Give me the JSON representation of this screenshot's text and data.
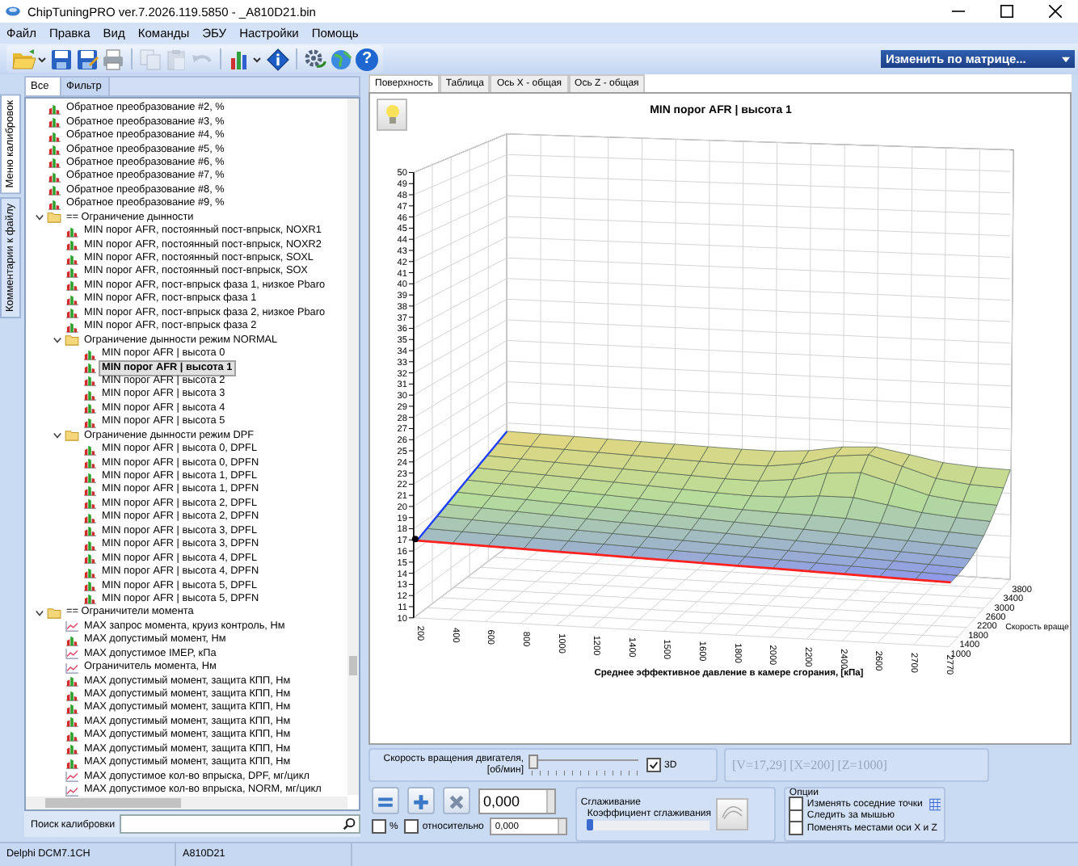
{
  "window": {
    "title": "ChipTuningPRO ver.7.2026.119.5850 - _A810D21.bin"
  },
  "menu": [
    "Файл",
    "Правка",
    "Вид",
    "Команды",
    "ЭБУ",
    "Настройки",
    "Помощь"
  ],
  "toolbar": [
    {
      "kind": "open",
      "disabled": false
    },
    {
      "kind": "save",
      "disabled": false
    },
    {
      "kind": "save-as",
      "disabled": false
    },
    {
      "kind": "print",
      "disabled": false
    },
    {
      "kind": "separator"
    },
    {
      "kind": "copy",
      "disabled": true
    },
    {
      "kind": "paste",
      "disabled": true
    },
    {
      "kind": "undo",
      "disabled": true
    },
    {
      "kind": "separator"
    },
    {
      "kind": "chart",
      "disabled": false
    },
    {
      "kind": "diamond",
      "disabled": false
    },
    {
      "kind": "separator"
    },
    {
      "kind": "gear",
      "disabled": false
    },
    {
      "kind": "globe",
      "disabled": false
    },
    {
      "kind": "help",
      "disabled": false,
      "glyph": "?"
    }
  ],
  "matrix_dropdown": {
    "label": "Изменить по матрице..."
  },
  "side_tabs": [
    {
      "label": "Меню калибровок",
      "selected": true
    },
    {
      "label": "Комментарии к файлу",
      "selected": false
    }
  ],
  "filter_tabs": [
    {
      "label": "Все",
      "selected": true
    },
    {
      "label": "Фильтр",
      "selected": false
    }
  ],
  "tree": [
    {
      "label": "Обратное преобразование #2, %",
      "kind": "map",
      "selected": false
    },
    {
      "label": "Обратное преобразование #3, %",
      "kind": "map",
      "selected": false
    },
    {
      "label": "Обратное преобразование #4, %",
      "kind": "map",
      "selected": false
    },
    {
      "label": "Обратное преобразование #5, %",
      "kind": "map",
      "selected": false
    },
    {
      "label": "Обратное преобразование #6, %",
      "kind": "map",
      "selected": false
    },
    {
      "label": "Обратное преобразование #7, %",
      "kind": "map",
      "selected": false
    },
    {
      "label": "Обратное преобразование #8, %",
      "kind": "map",
      "selected": false
    },
    {
      "label": "Обратное преобразование #9, %",
      "kind": "map",
      "selected": false
    },
    {
      "label": "== Ограничение дынности",
      "kind": "folder",
      "expanded": true,
      "children": [
        {
          "label": "MIN порог AFR, постоянный пост-впрыск, NOXR1",
          "kind": "map",
          "selected": false
        },
        {
          "label": "MIN порог AFR, постоянный пост-впрыск, NOXR2",
          "kind": "map",
          "selected": false
        },
        {
          "label": "MIN порог AFR, постоянный пост-впрыск, SOXL",
          "kind": "map",
          "selected": false
        },
        {
          "label": "MIN порог AFR, постоянный пост-впрыск, SOX",
          "kind": "map",
          "selected": false
        },
        {
          "label": "MIN порог AFR, пост-впрыск фаза 1, низкое Pbaro",
          "kind": "map",
          "selected": false
        },
        {
          "label": "MIN порог AFR, пост-впрыск фаза 1",
          "kind": "map",
          "selected": false
        },
        {
          "label": "MIN порог AFR, пост-впрыск фаза 2, низкое Pbaro",
          "kind": "map",
          "selected": false
        },
        {
          "label": "MIN порог AFR, пост-впрыск фаза 2",
          "kind": "map",
          "selected": false
        },
        {
          "label": "Ограничение дынности режим NORMAL",
          "kind": "folder",
          "expanded": true,
          "children": [
            {
              "label": "MIN порог AFR | высота 0",
              "kind": "map",
              "selected": false
            },
            {
              "label": "MIN порог AFR | высота 1",
              "kind": "map",
              "selected": true
            },
            {
              "label": "MIN порог AFR | высота 2",
              "kind": "map",
              "selected": false
            },
            {
              "label": "MIN порог AFR | высота 3",
              "kind": "map",
              "selected": false
            },
            {
              "label": "MIN порог AFR | высота 4",
              "kind": "map",
              "selected": false
            },
            {
              "label": "MIN порог AFR | высота 5",
              "kind": "map",
              "selected": false
            }
          ]
        },
        {
          "label": "Ограничение дынности режим DPF",
          "kind": "folder",
          "expanded": true,
          "children": [
            {
              "label": "MIN порог AFR | высота 0, DPFL",
              "kind": "map",
              "selected": false
            },
            {
              "label": "MIN порог AFR | высота 0, DPFN",
              "kind": "map",
              "selected": false
            },
            {
              "label": "MIN порог AFR | высота 1, DPFL",
              "kind": "map",
              "selected": false
            },
            {
              "label": "MIN порог AFR | высота 1, DPFN",
              "kind": "map",
              "selected": false
            },
            {
              "label": "MIN порог AFR | высота 2, DPFL",
              "kind": "map",
              "selected": false
            },
            {
              "label": "MIN порог AFR | высота 2, DPFN",
              "kind": "map",
              "selected": false
            },
            {
              "label": "MIN порог AFR | высота 3, DPFL",
              "kind": "map",
              "selected": false
            },
            {
              "label": "MIN порог AFR | высота 3, DPFN",
              "kind": "map",
              "selected": false
            },
            {
              "label": "MIN порог AFR | высота 4, DPFL",
              "kind": "map",
              "selected": false
            },
            {
              "label": "MIN порог AFR | высота 4, DPFN",
              "kind": "map",
              "selected": false
            },
            {
              "label": "MIN порог AFR | высота 5, DPFL",
              "kind": "map",
              "selected": false
            },
            {
              "label": "MIN порог AFR | высота 5, DPFN",
              "kind": "map",
              "selected": false
            }
          ]
        }
      ]
    },
    {
      "label": "== Ограничители момента",
      "kind": "folder",
      "expanded": true,
      "children": [
        {
          "label": "MAX запрос момента, круиз контроль, Нм",
          "kind": "curve",
          "selected": false
        },
        {
          "label": "MAX допустимый момент, Нм",
          "kind": "map",
          "selected": false
        },
        {
          "label": "MAX допустимое IMEP, кПа",
          "kind": "curve",
          "selected": false
        },
        {
          "label": "Ограничитель момента, Нм",
          "kind": "curve",
          "selected": false
        },
        {
          "label": "MAX допустимый момент, защита КПП, Нм",
          "kind": "map",
          "selected": false
        },
        {
          "label": "MAX допустимый момент, защита КПП, Нм",
          "kind": "map",
          "selected": false
        },
        {
          "label": "MAX допустимый момент, защита КПП, Нм",
          "kind": "map",
          "selected": false
        },
        {
          "label": "MAX допустимый момент, защита КПП, Нм",
          "kind": "map",
          "selected": false
        },
        {
          "label": "MAX допустимый момент, защита КПП, Нм",
          "kind": "map",
          "selected": false
        },
        {
          "label": "MAX допустимый момент, защита КПП, Нм",
          "kind": "map",
          "selected": false
        },
        {
          "label": "MAX допустимый момент, защита КПП, Нм",
          "kind": "map",
          "selected": false
        },
        {
          "label": "MAX допустимое кол-во впрыска, DPF, мг/цикл",
          "kind": "curve",
          "selected": false
        },
        {
          "label": "MAX допустимое кол-во впрыска, NORM, мг/цикл",
          "kind": "curve",
          "selected": false
        }
      ]
    }
  ],
  "search": {
    "label": "Поиск калибровки"
  },
  "view_tabs": [
    {
      "label": "Поверхность",
      "selected": true
    },
    {
      "label": "Таблица",
      "selected": false
    },
    {
      "label": "Ось X - общая",
      "selected": false
    },
    {
      "label": "Ось Z - общая",
      "selected": false
    }
  ],
  "surface": {
    "title": "MIN порог AFR | высота 1",
    "z_ticks": [
      "50",
      "49",
      "48",
      "47",
      "46",
      "45",
      "44",
      "43",
      "42",
      "41",
      "40",
      "39",
      "38",
      "37",
      "36",
      "35",
      "34",
      "33",
      "32",
      "31",
      "30",
      "29",
      "28",
      "27",
      "26",
      "25",
      "24",
      "23",
      "22",
      "21",
      "20",
      "19",
      "18",
      "17",
      "16",
      "15",
      "14",
      "13",
      "12",
      "11",
      "10"
    ],
    "x_ticks": [
      "200",
      "400",
      "600",
      "800",
      "1000",
      "1200",
      "1400",
      "1500",
      "1600",
      "1800",
      "2000",
      "2200",
      "2400",
      "2600",
      "2700",
      "2770"
    ],
    "depth_ticks": [
      "3800",
      "3400",
      "3000",
      "2600",
      "2200",
      "1800",
      "1400",
      "1000"
    ],
    "x_label": "Среднее эффективное давление в камере сгорания, [кПа]",
    "depth_label": "Скорость враще"
  },
  "rpm_slider": {
    "label": "Скорость вращения двигателя, [об/мин]",
    "level": 0
  },
  "view_3d": {
    "label": "3D",
    "checked": true
  },
  "readout": "[V=17,29] [X=200] [Z=1000]",
  "edit": {
    "value": "0,000",
    "percent": {
      "label": "%",
      "checked": false
    },
    "relative": {
      "label": "относительно",
      "checked": false
    },
    "relative_value": "0,000"
  },
  "smoothing": {
    "title": "Сглаживание",
    "label": "Коэффициент сглаживания",
    "level": 0
  },
  "options": {
    "title": "Опции",
    "items": [
      {
        "label": "Изменять соседние точки",
        "checked": false
      },
      {
        "label": "Следить за мышью",
        "checked": false
      },
      {
        "label": "Поменять местами оси X и Z",
        "checked": false
      }
    ]
  },
  "status_bar": [
    "Delphi DCM7.1CH",
    "A810D21"
  ]
}
